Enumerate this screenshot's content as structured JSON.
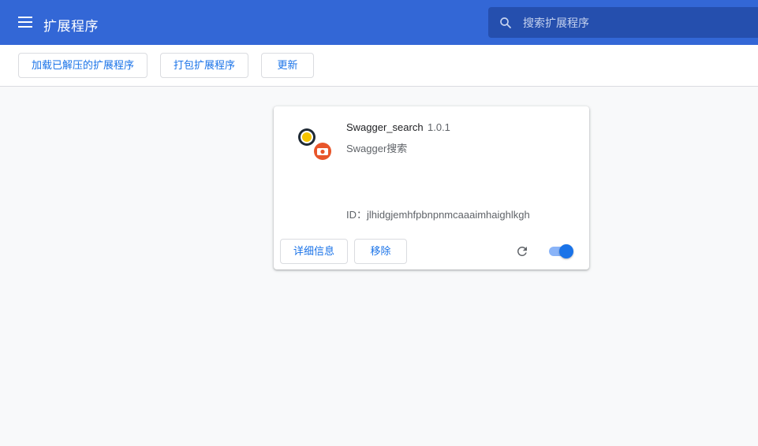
{
  "header": {
    "title": "扩展程序",
    "menu_icon": "menu-icon",
    "search": {
      "placeholder": "搜索扩展程序",
      "value": "",
      "icon": "search-icon"
    }
  },
  "toolbar": {
    "load_unpacked_label": "加载已解压的扩展程序",
    "pack_label": "打包扩展程序",
    "update_label": "更新"
  },
  "extension": {
    "name": "Swagger_search",
    "version": "1.0.1",
    "description": "Swagger搜索",
    "id_text": "ID：jlhidgjemhfpbnpnmcaaaimhaighlkgh",
    "details_label": "详细信息",
    "remove_label": "移除",
    "reload_icon": "reload-icon",
    "enabled": true
  },
  "colors": {
    "header_bg": "#3367d6",
    "search_bg": "#254fae",
    "accent": "#1a73e8",
    "page_bg": "#f8f9fa"
  }
}
